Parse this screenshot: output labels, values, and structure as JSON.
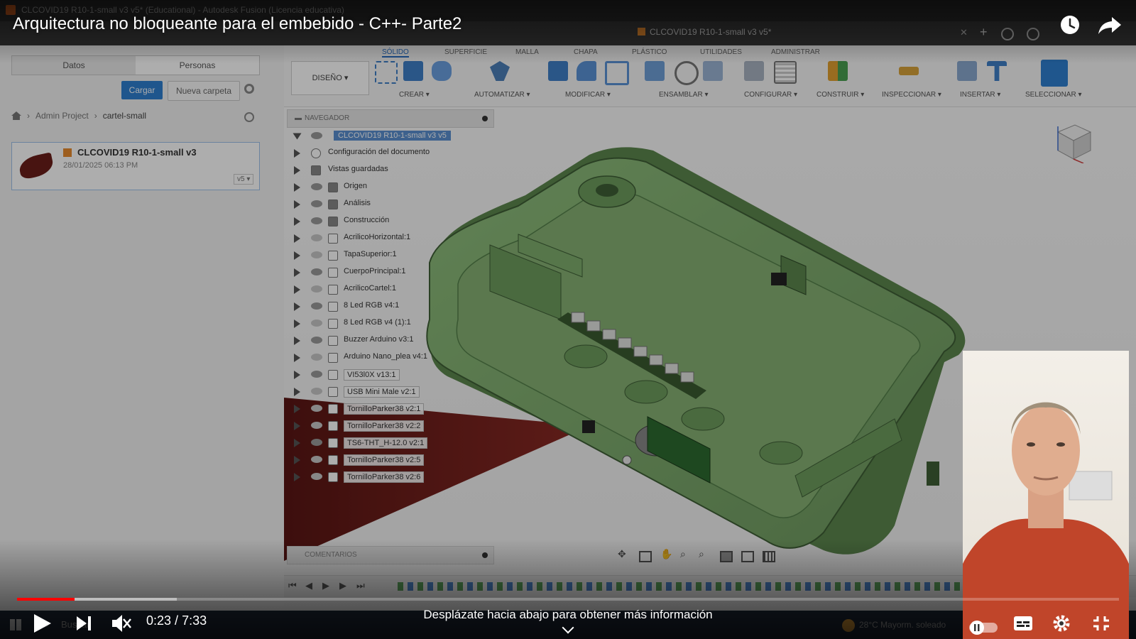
{
  "video": {
    "title": "Arquitectura no bloqueante para el embebido - C++- Parte2",
    "time_current": "0:23",
    "time_separator": " / ",
    "time_total": "7:33",
    "progress_played_fraction": 0.052,
    "progress_buffered_fraction": 0.145,
    "scroll_hint": "Desplázate hacia abajo para obtener más información"
  },
  "fusion": {
    "window_title": "CLCOVID19 R10-1-small v3 v5* (Educational) - Autodesk Fusion (Licencia educativa)",
    "document_tab": "CLCOVID19 R10-1-small v3 v5*",
    "data_panel": {
      "tabs": [
        "Datos",
        "Personas"
      ],
      "load_button": "Cargar",
      "new_folder_button": "Nueva carpeta",
      "breadcrumb": [
        "Admin Project",
        "cartel-small"
      ],
      "file_name": "CLCOVID19 R10-1-small v3",
      "file_date": "28/01/2025 06:13 PM",
      "file_version": "v5 ▾"
    },
    "ribbon": {
      "tabs": [
        "SÓLIDO",
        "SUPERFICIE",
        "MALLA",
        "CHAPA",
        "PLÁSTICO",
        "UTILIDADES",
        "ADMINISTRAR"
      ],
      "workspace": "DISEÑO ▾",
      "groups": [
        "CREAR ▾",
        "AUTOMATIZAR ▾",
        "MODIFICAR ▾",
        "ENSAMBLAR ▾",
        "CONFIGURAR ▾",
        "CONSTRUIR ▾",
        "INSPECCIONAR ▾",
        "INSERTAR ▾",
        "SELECCIONAR ▾"
      ]
    },
    "browser": {
      "title": "NAVEGADOR",
      "root": "CLCOVID19 R10-1-small v3 v5",
      "items": [
        "Configuración del documento",
        "Vistas guardadas",
        "Origen",
        "Análisis",
        "Construcción",
        "AcrilicoHorizontal:1",
        "TapaSuperior:1",
        "CuerpoPrincipal:1",
        "AcrilicoCartel:1",
        "8 Led RGB v4:1",
        "8 Led RGB v4 (1):1",
        "Buzzer Arduino v3:1",
        "Arduino Nano_plea v4:1",
        "VI53l0X v13:1",
        "USB Mini Male v2:1",
        "TornilloParker38 v2:1",
        "TornilloParker38 v2:2",
        "TS6-THT_H-12.0 v2:1",
        "TornilloParker38 v2:5",
        "TornilloParker38 v2:6"
      ]
    },
    "comments_title": "COMENTARIOS"
  },
  "taskbar": {
    "search": "Buscar",
    "weather": "28°C  Mayorm. soleado"
  },
  "colors": {
    "model_green": "#7aa56a",
    "progress_red": "#ff0000",
    "accent_blue": "#2f7fd0"
  }
}
